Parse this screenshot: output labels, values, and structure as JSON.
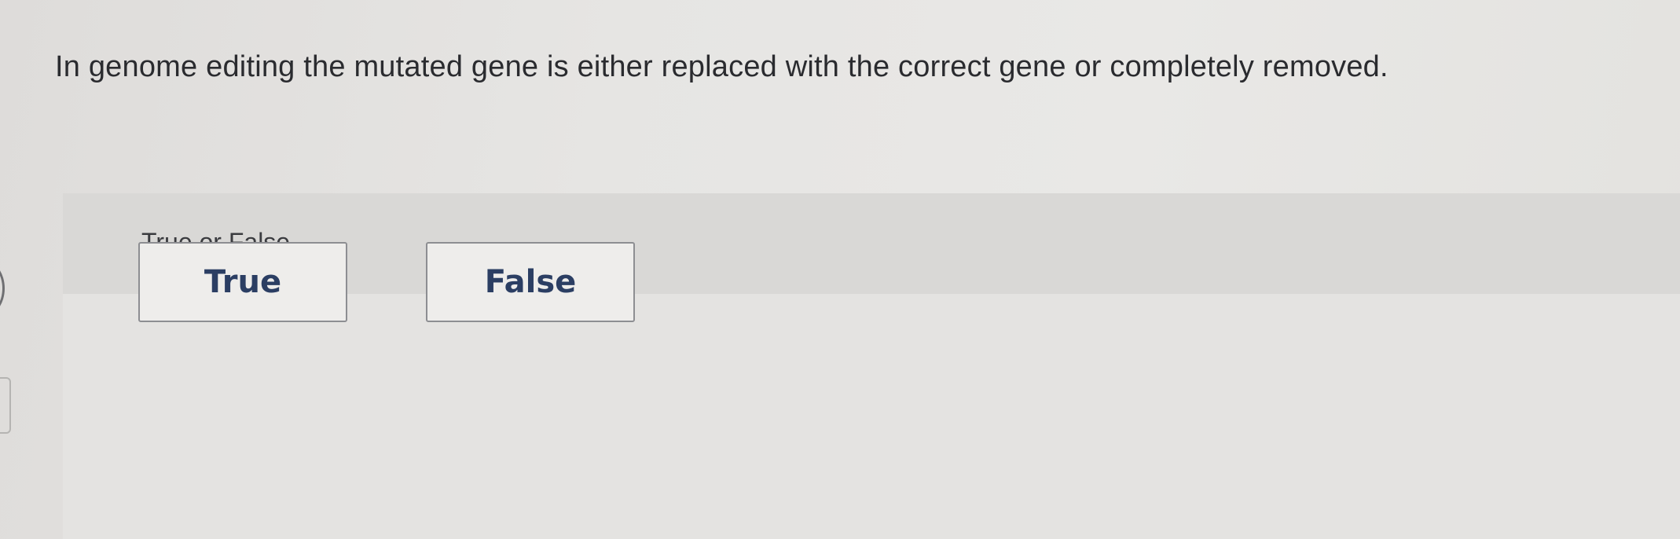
{
  "question": {
    "text": "In genome editing the mutated gene is either replaced with the correct gene or completely removed."
  },
  "prompt": {
    "text": "True or False"
  },
  "options": {
    "true_label": "True",
    "false_label": "False"
  },
  "colors": {
    "button_text": "#2b3e63",
    "button_border": "#8d8e92",
    "question_text": "#2a2b2f",
    "panel_header": "#d9d8d6"
  }
}
